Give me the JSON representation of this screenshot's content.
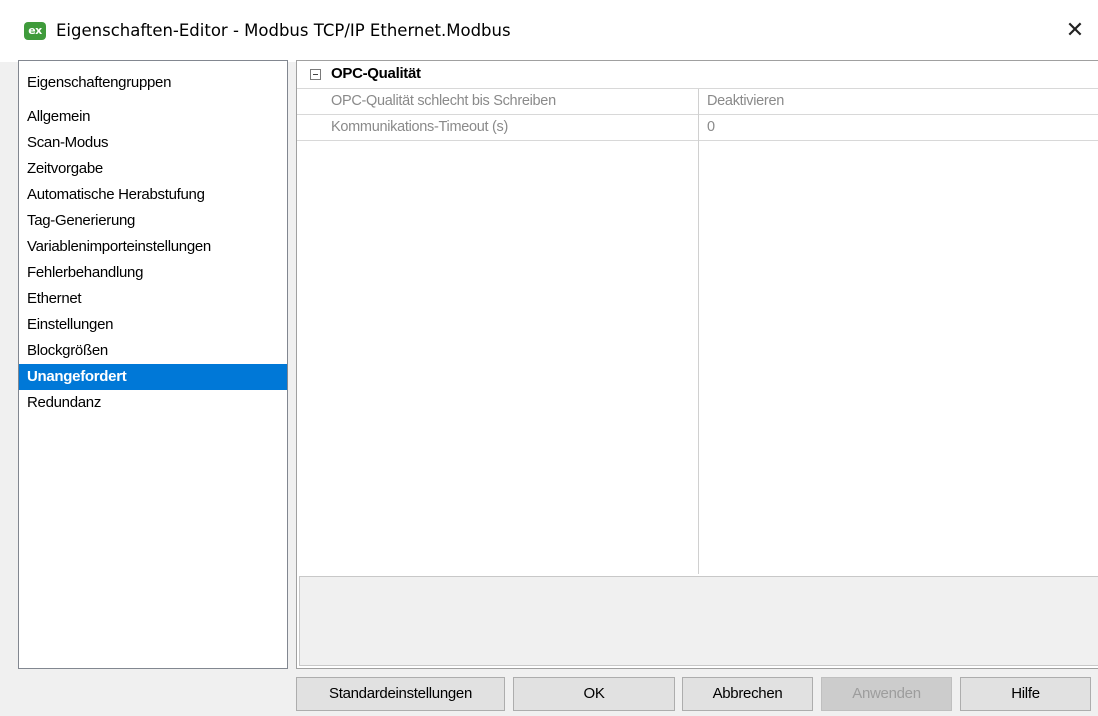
{
  "window": {
    "app_icon_text": "ex",
    "title": "Eigenschaften-Editor - Modbus TCP/IP Ethernet.Modbus",
    "close_symbol": "✕"
  },
  "groups": {
    "title": "Eigenschaftengruppen",
    "items": [
      {
        "label": "Allgemein"
      },
      {
        "label": "Scan-Modus"
      },
      {
        "label": "Zeitvorgabe"
      },
      {
        "label": "Automatische Herabstufung"
      },
      {
        "label": "Tag-Generierung"
      },
      {
        "label": "Variablenimporteinstellungen"
      },
      {
        "label": "Fehlerbehandlung"
      },
      {
        "label": "Ethernet"
      },
      {
        "label": "Einstellungen"
      },
      {
        "label": "Blockgrößen"
      },
      {
        "label": "Unangefordert",
        "selected": true
      },
      {
        "label": "Redundanz"
      }
    ]
  },
  "property_grid": {
    "category": "OPC-Qualität",
    "properties": [
      {
        "name": "OPC-Qualität schlecht bis Schreiben",
        "value": "Deaktivieren"
      },
      {
        "name": "Kommunikations-Timeout (s)",
        "value": "0"
      }
    ],
    "description": ""
  },
  "buttons": {
    "defaults": "Standardeinstellungen",
    "ok": "OK",
    "cancel": "Abbrechen",
    "apply": "Anwenden",
    "help": "Hilfe"
  },
  "colors": {
    "selection": "#0078d7",
    "app_icon": "#3f9b3b"
  },
  "icons": {
    "app": "ex-app-icon",
    "close": "close-icon",
    "collapse": "collapse-minus-icon"
  }
}
